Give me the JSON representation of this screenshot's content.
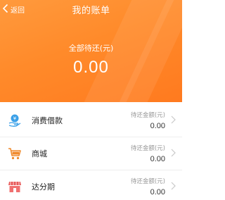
{
  "nav": {
    "back_label": "返回",
    "title": "我的账单"
  },
  "summary": {
    "label": "全部待还(元)",
    "amount": "0.00"
  },
  "accent_color": "#ff8a2a",
  "rows": [
    {
      "name": "消费借款",
      "due_label": "待还金额(元)",
      "due_amount": "0.00",
      "icon": "loan-icon"
    },
    {
      "name": "商城",
      "due_label": "待还金额(元)",
      "due_amount": "0.00",
      "icon": "shopping-cart-icon"
    },
    {
      "name": "达分期",
      "due_label": "待还金额(元)",
      "due_amount": "0.00",
      "icon": "store-icon"
    }
  ]
}
